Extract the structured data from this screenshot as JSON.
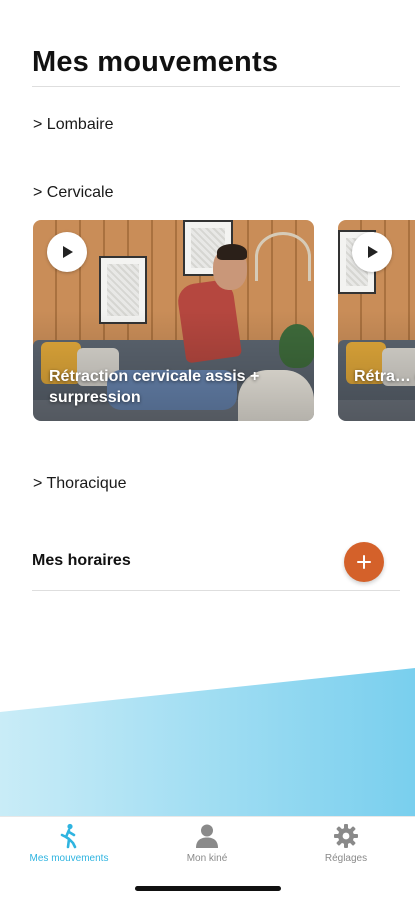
{
  "page": {
    "title": "Mes mouvements"
  },
  "sections": {
    "lombaire": "> Lombaire",
    "cervicale": "> Cervicale",
    "thoracique": "> Thoracique"
  },
  "videos": [
    {
      "title": "Rétraction cervicale assis + surpression"
    },
    {
      "title": "Rétra… exten…"
    }
  ],
  "schedules": {
    "title": "Mes horaires",
    "add_icon": "plus-icon"
  },
  "tabs": [
    {
      "label": "Mes mouvements",
      "icon": "walking-person-icon",
      "active": true
    },
    {
      "label": "Mon kiné",
      "icon": "person-icon",
      "active": false
    },
    {
      "label": "Réglages",
      "icon": "gear-icon",
      "active": false
    }
  ],
  "colors": {
    "accent": "#2fb4e0",
    "add_button": "#d4612a",
    "wave_light": "#c9ecf7",
    "wave_dark": "#79cfee",
    "inactive_tab": "#8a8a8a"
  }
}
